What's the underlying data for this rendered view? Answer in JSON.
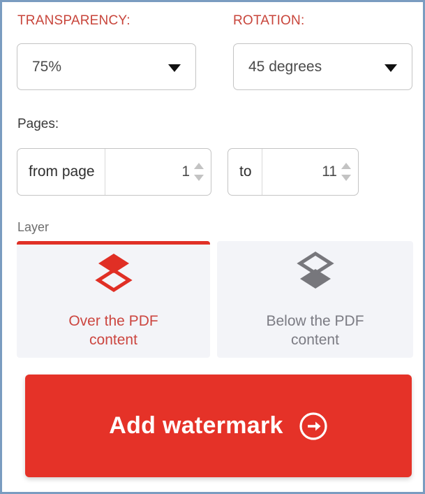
{
  "panel": {
    "border_color": "#7a9cc0",
    "background": "#ffffff"
  },
  "transparency": {
    "label": "TRANSPARENCY:",
    "selected_value": "75%",
    "caret_icon": "chevron-down-icon"
  },
  "rotation": {
    "label": "ROTATION:",
    "selected_value": "45 degrees",
    "caret_icon": "chevron-down-icon"
  },
  "pages": {
    "label": "Pages:",
    "from": {
      "prefix": "from page",
      "value": "1",
      "up_icon": "spinner-up-icon",
      "down_icon": "spinner-down-icon"
    },
    "to": {
      "prefix": "to",
      "value": "11",
      "up_icon": "spinner-up-icon",
      "down_icon": "spinner-down-icon"
    }
  },
  "layer": {
    "label": "Layer",
    "options": [
      {
        "text": "Over the PDF\ncontent",
        "icon": "layer-over-icon",
        "selected": true,
        "color": "#cc4640"
      },
      {
        "text": "Below the PDF\ncontent",
        "icon": "layer-below-icon",
        "selected": false,
        "color": "#7b7b83"
      }
    ]
  },
  "cta": {
    "label": "Add watermark",
    "icon": "arrow-right-circle-icon",
    "background": "#e53228",
    "text_color": "#ffffff"
  },
  "colors": {
    "accent_red": "#e03127",
    "label_red": "#c8453b",
    "card_bg": "#f3f4f8",
    "border_gray": "#c4c4c4"
  }
}
